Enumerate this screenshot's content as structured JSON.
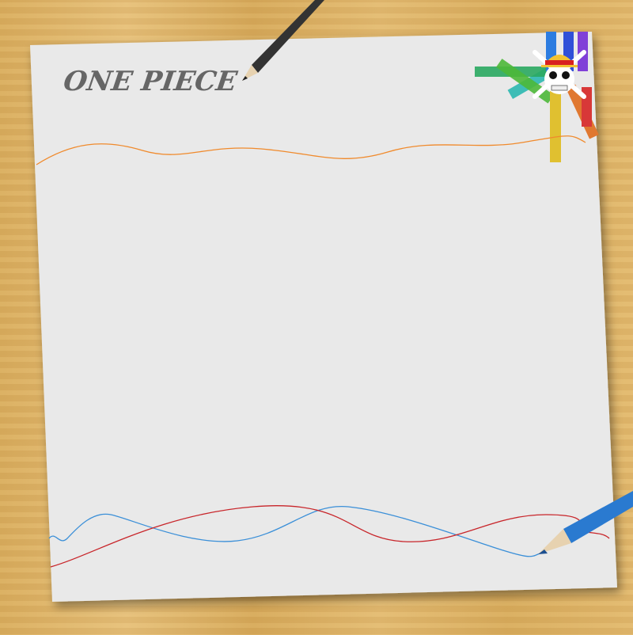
{
  "title": "ONE PIECE",
  "logo": "straw-hat-jolly-roger",
  "colors": {
    "paper": "#e9e9e9",
    "orange_line": "#f08a2c",
    "blue_line": "#3a8fd8",
    "red_line": "#c8252a",
    "title": "#666666",
    "wood": "#ddb266"
  }
}
